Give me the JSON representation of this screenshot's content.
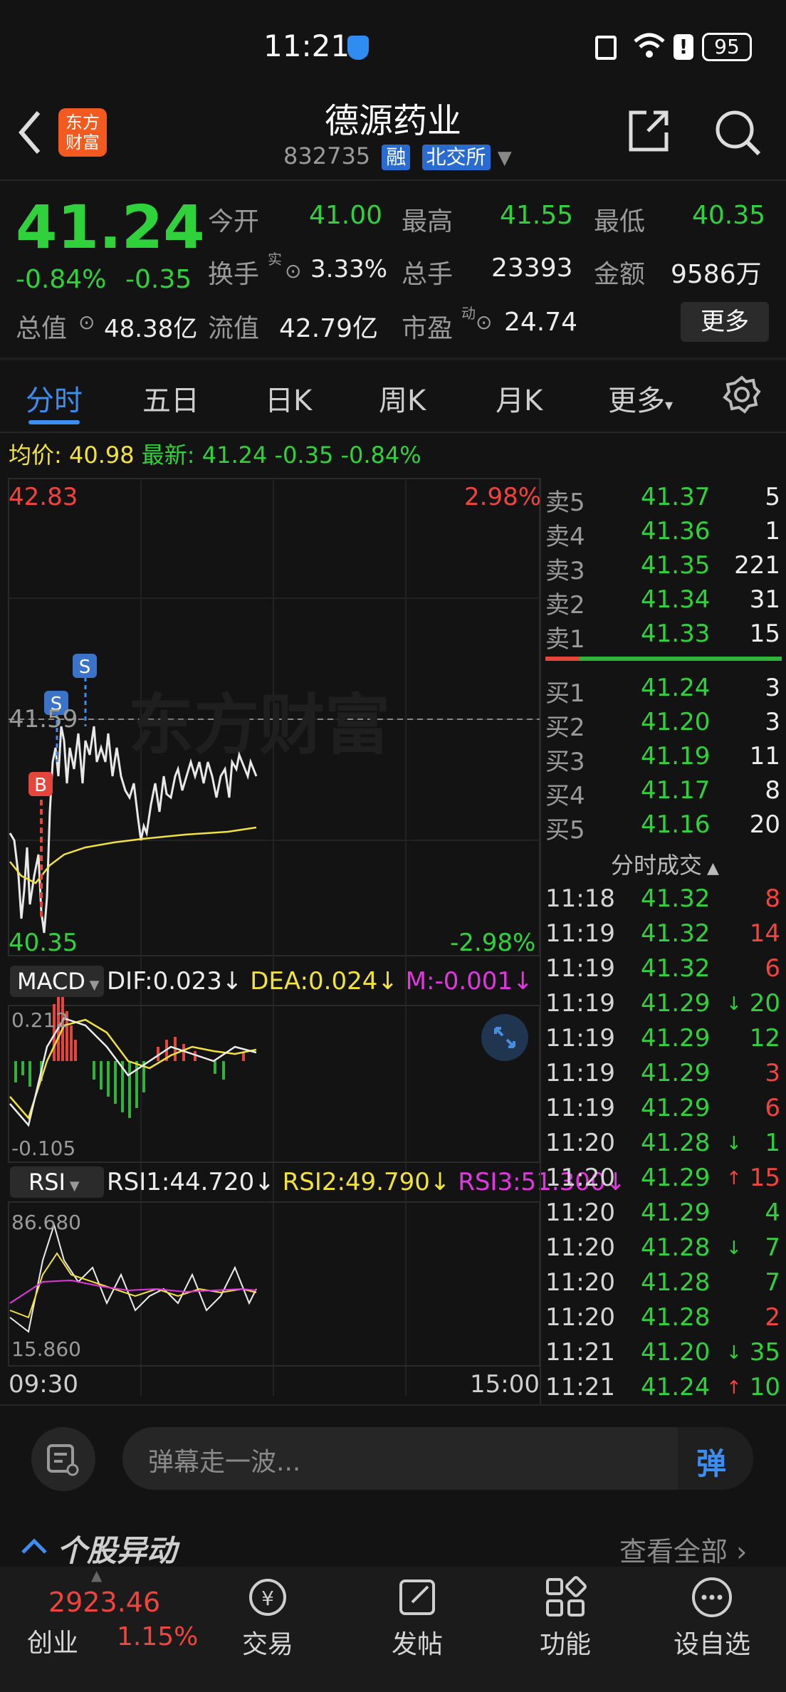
{
  "status": {
    "time": "11:21",
    "battery": "95"
  },
  "header": {
    "title": "德源药业",
    "code": "832735",
    "tag1": "融",
    "tag2": "北交所",
    "logo": "东方\n财富"
  },
  "quote": {
    "price": "41.24",
    "pct": "-0.84%",
    "chg": "-0.35",
    "open_label": "今开",
    "open": "41.00",
    "high_label": "最高",
    "high": "41.55",
    "low_label": "最低",
    "low": "40.35",
    "turnover_label": "换手",
    "turnover_sup": "实",
    "turnover": "3.33%",
    "volume_label": "总手",
    "volume": "23393",
    "amount_label": "金额",
    "amount": "9586万",
    "mcap_label": "总值",
    "mcap": "48.38亿",
    "float_label": "流值",
    "float": "42.79亿",
    "pe_label": "市盈",
    "pe_sup": "动",
    "pe": "24.74",
    "more": "更多"
  },
  "tabs": [
    "分时",
    "五日",
    "日K",
    "周K",
    "月K",
    "更多"
  ],
  "chart": {
    "avg_label": "均价:",
    "avg": "40.98",
    "latest_label": "最新:",
    "latest": "41.24",
    "latest_chg": "-0.35",
    "latest_pct": "-0.84%",
    "ymax": "42.83",
    "ymin": "40.35",
    "pmax": "2.98%",
    "pmin": "-2.98%",
    "mid": "41.59",
    "watermark": "东方财富",
    "t_start": "09:30",
    "t_end": "15:00",
    "macd_label": "MACD",
    "dif": "DIF:0.023",
    "dea": "DEA:0.024",
    "m": "M:-0.001",
    "macd_top": "0.212",
    "macd_bot": "-0.105",
    "rsi_label": "RSI",
    "rsi1": "RSI1:44.720",
    "rsi2": "RSI2:49.790",
    "rsi3": "RSI3:51.300",
    "rsi_top": "86.680",
    "rsi_bot": "15.860",
    "arrow": "↓",
    "marker_b": "B",
    "marker_s": "S"
  },
  "orderbook": {
    "asks": [
      {
        "label": "卖5",
        "price": "41.37",
        "vol": "5"
      },
      {
        "label": "卖4",
        "price": "41.36",
        "vol": "1"
      },
      {
        "label": "卖3",
        "price": "41.35",
        "vol": "221"
      },
      {
        "label": "卖2",
        "price": "41.34",
        "vol": "31"
      },
      {
        "label": "卖1",
        "price": "41.33",
        "vol": "15"
      }
    ],
    "bids": [
      {
        "label": "买1",
        "price": "41.24",
        "vol": "3"
      },
      {
        "label": "买2",
        "price": "41.20",
        "vol": "3"
      },
      {
        "label": "买3",
        "price": "41.19",
        "vol": "11"
      },
      {
        "label": "买4",
        "price": "41.17",
        "vol": "8"
      },
      {
        "label": "买5",
        "price": "41.16",
        "vol": "20"
      }
    ],
    "ticks_title": "分时成交",
    "ticks": [
      {
        "t": "11:18",
        "p": "41.32",
        "a": "",
        "v": "8",
        "vc": "r"
      },
      {
        "t": "11:19",
        "p": "41.32",
        "a": "",
        "v": "14",
        "vc": "r"
      },
      {
        "t": "11:19",
        "p": "41.32",
        "a": "",
        "v": "6",
        "vc": "r"
      },
      {
        "t": "11:19",
        "p": "41.29",
        "a": "↓",
        "v": "20",
        "vc": "g"
      },
      {
        "t": "11:19",
        "p": "41.29",
        "a": "",
        "v": "12",
        "vc": "g"
      },
      {
        "t": "11:19",
        "p": "41.29",
        "a": "",
        "v": "3",
        "vc": "r"
      },
      {
        "t": "11:19",
        "p": "41.29",
        "a": "",
        "v": "6",
        "vc": "r"
      },
      {
        "t": "11:20",
        "p": "41.28",
        "a": "↓",
        "v": "1",
        "vc": "g"
      },
      {
        "t": "11:20",
        "p": "41.29",
        "a": "↑",
        "v": "15",
        "vc": "r"
      },
      {
        "t": "11:20",
        "p": "41.29",
        "a": "",
        "v": "4",
        "vc": "g"
      },
      {
        "t": "11:20",
        "p": "41.28",
        "a": "↓",
        "v": "7",
        "vc": "g"
      },
      {
        "t": "11:20",
        "p": "41.28",
        "a": "",
        "v": "7",
        "vc": "g"
      },
      {
        "t": "11:20",
        "p": "41.28",
        "a": "",
        "v": "2",
        "vc": "r"
      },
      {
        "t": "11:21",
        "p": "41.20",
        "a": "↓",
        "v": "35",
        "vc": "g"
      },
      {
        "t": "11:21",
        "p": "41.24",
        "a": "↑",
        "v": "10",
        "vc": "g"
      }
    ]
  },
  "danmu": {
    "placeholder": "弹幕走一波...",
    "btn": "弹"
  },
  "news": {
    "title": "个股异动",
    "more": "查看全部"
  },
  "nav": {
    "index_value": "2923.46",
    "index_name": "创业",
    "index_pct": "1.15%",
    "items": [
      "交易",
      "发帖",
      "功能",
      "设自选"
    ]
  }
}
